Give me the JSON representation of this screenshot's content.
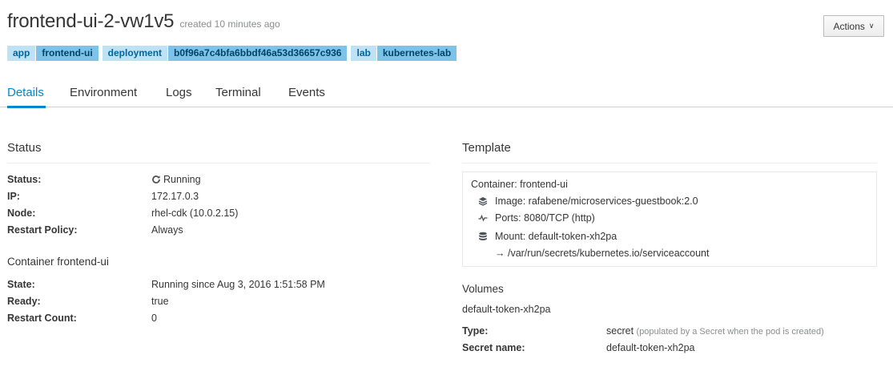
{
  "header": {
    "pod_name": "frontend-ui-2-vw1v5",
    "age": "created 10 minutes ago",
    "actions_label": "Actions",
    "actions_caret": "∨"
  },
  "labels": [
    {
      "key": "app",
      "value": "frontend-ui"
    },
    {
      "key": "deployment",
      "value": "b0f96a7c4bfa6bbdf46a53d36657c936"
    },
    {
      "key": "lab",
      "value": "kubernetes-lab"
    }
  ],
  "tabs": [
    {
      "label": "Details",
      "active": true
    },
    {
      "label": "Environment",
      "active": false
    },
    {
      "label": "Logs",
      "active": false
    },
    {
      "label": "Terminal",
      "active": false
    },
    {
      "label": "Events",
      "active": false
    }
  ],
  "status": {
    "title": "Status",
    "rows": [
      {
        "label": "Status:",
        "value": "Running"
      },
      {
        "label": "IP:",
        "value": "172.17.0.3"
      },
      {
        "label": "Node:",
        "value": "rhel-cdk (10.0.2.15)"
      },
      {
        "label": "Restart Policy:",
        "value": "Always"
      }
    ]
  },
  "container": {
    "title": "Container frontend-ui",
    "rows": [
      {
        "label": "State:",
        "value": "Running since Aug 3, 2016 1:51:58 PM"
      },
      {
        "label": "Ready:",
        "value": "true"
      },
      {
        "label": "Restart Count:",
        "value": "0"
      }
    ]
  },
  "template": {
    "title": "Template",
    "container_line": "Container: frontend-ui",
    "image": "Image: rafabene/microservices-guestbook:2.0",
    "ports": "Ports: 8080/TCP (http)",
    "mount": "Mount: default-token-xh2pa",
    "mount_path": "→ /var/run/secrets/kubernetes.io/serviceaccount"
  },
  "volumes": {
    "title": "Volumes",
    "name": "default-token-xh2pa",
    "type_label": "Type:",
    "type_value": "secret",
    "type_hint": "(populated by a Secret when the pod is created)",
    "secret_label": "Secret name:",
    "secret_value": "default-token-xh2pa"
  },
  "icons": {
    "running": "refresh-icon",
    "image": "layers-icon",
    "ports": "pulse-icon",
    "mount": "database-icon"
  },
  "colors": {
    "accent": "#0088ce",
    "label_key_bg": "#bee1f4",
    "label_value_bg": "#7dc3e8"
  }
}
